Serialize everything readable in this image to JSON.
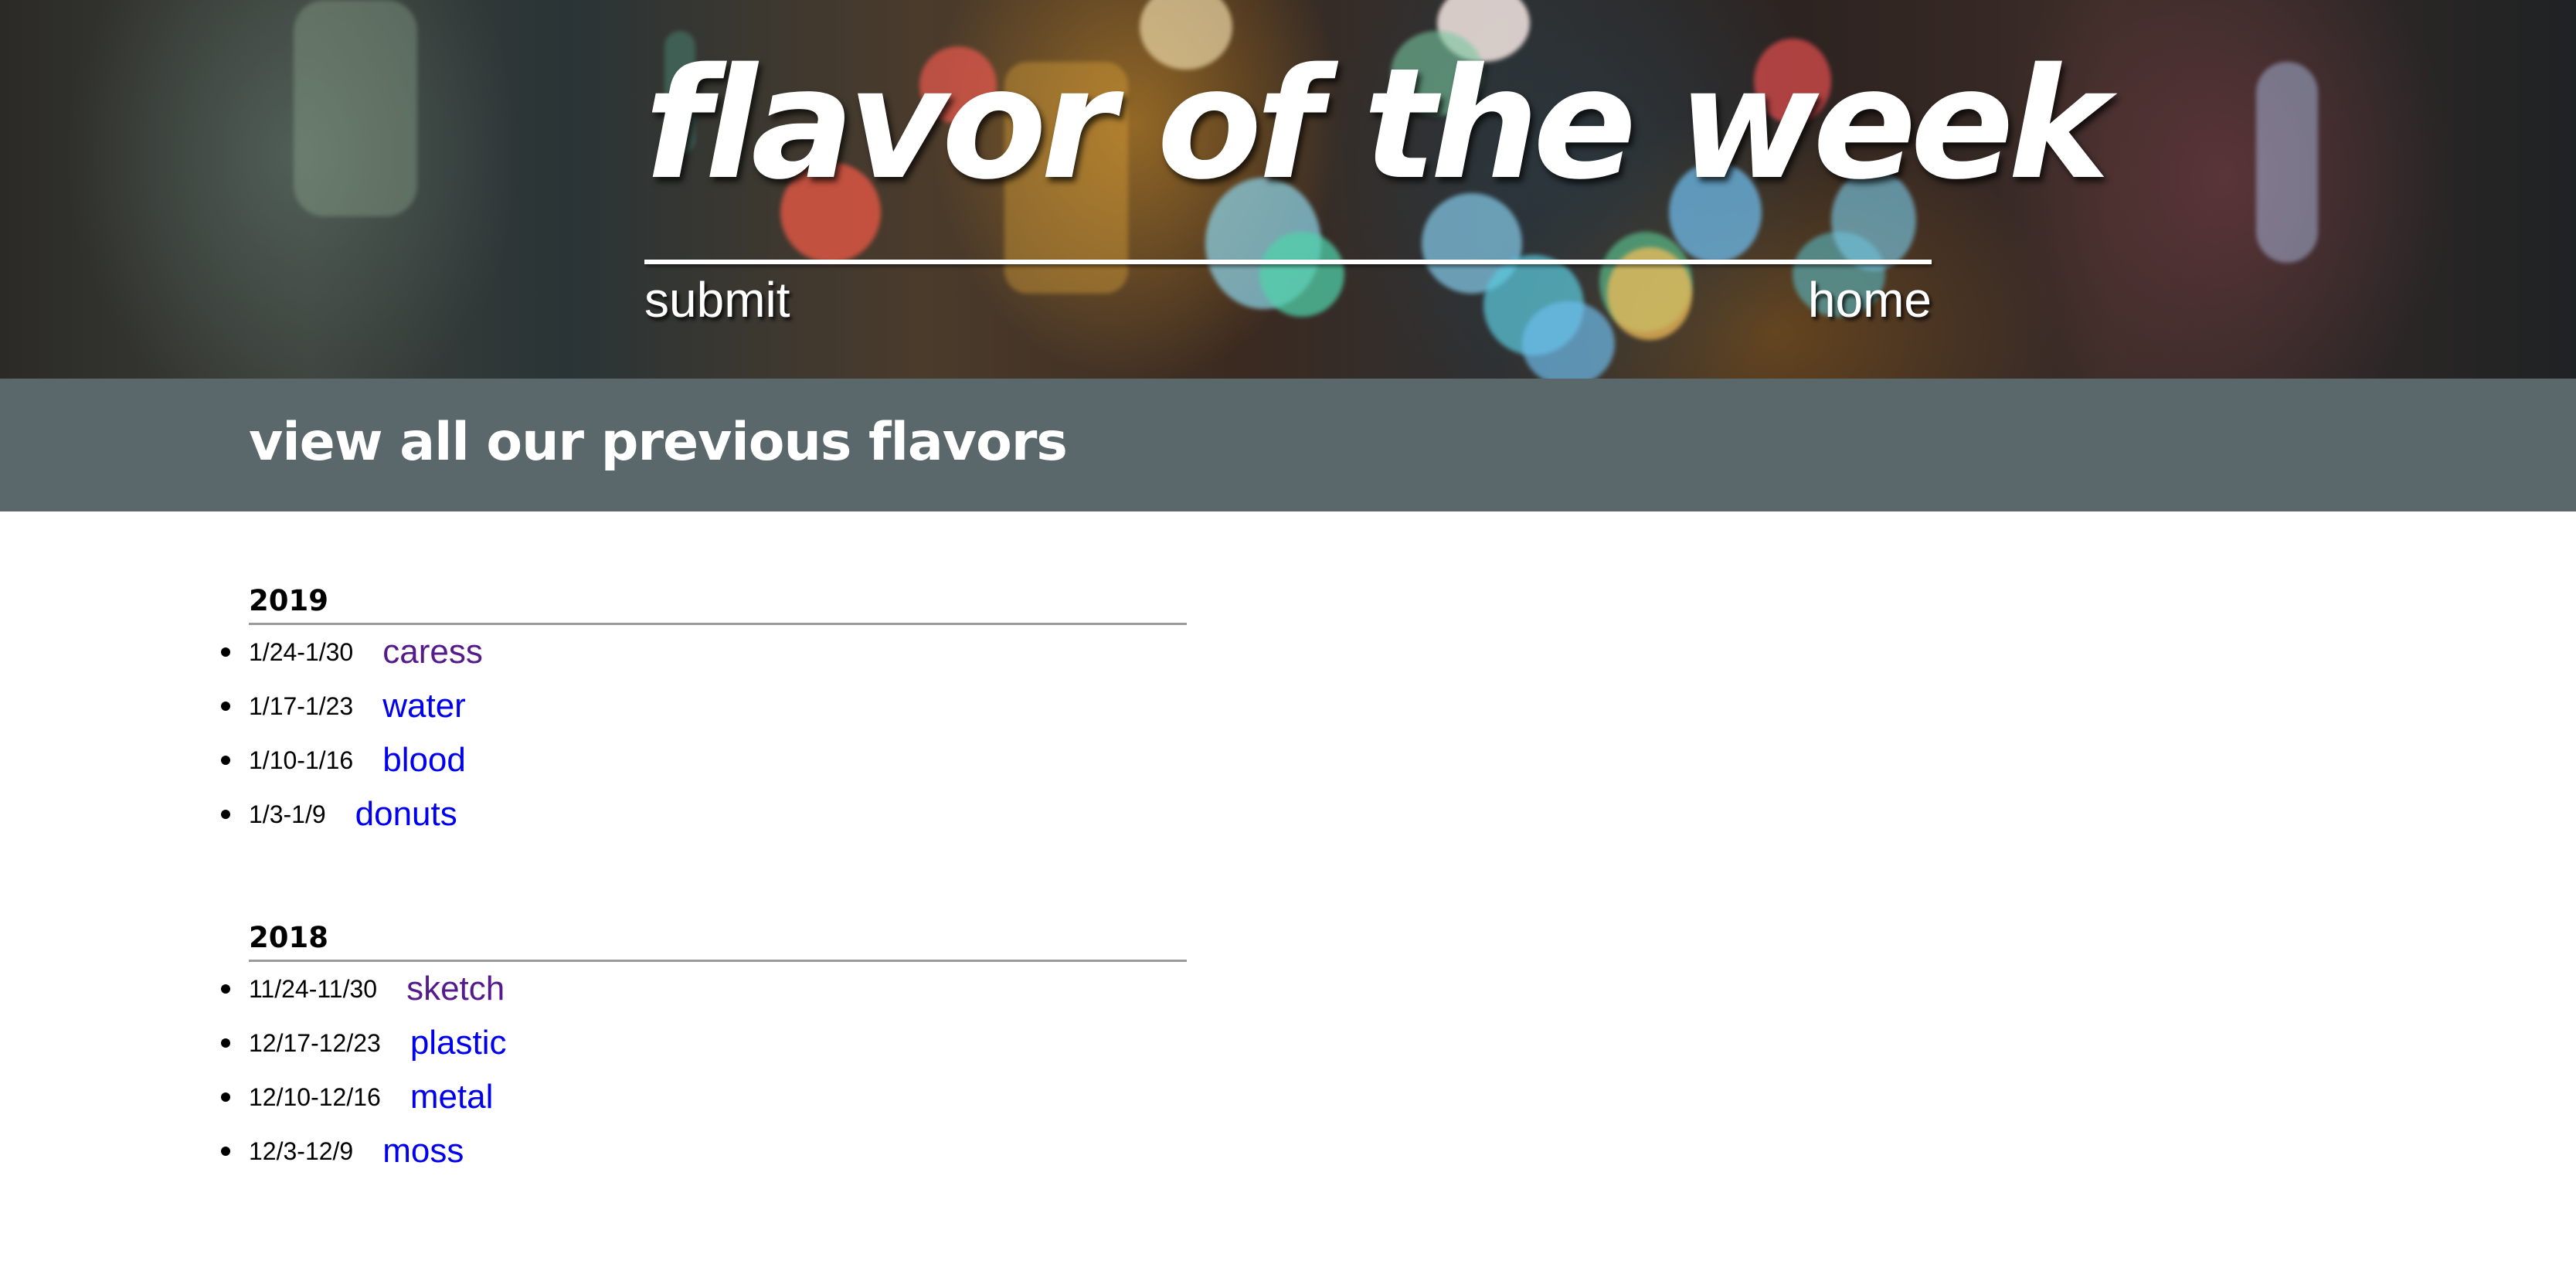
{
  "header": {
    "title": "flavor of the week",
    "nav": {
      "submit_label": "submit",
      "home_label": "home"
    }
  },
  "band": {
    "title": "view all our previous flavors"
  },
  "colors": {
    "band_background": "#5a676b",
    "link_unvisited": "#0000ee",
    "link_visited": "#551a8b",
    "rule": "#9a9a9a"
  },
  "archive": [
    {
      "year": "2019",
      "weeks": [
        {
          "dates": "1/24-1/30",
          "flavor": "caress",
          "visited": true
        },
        {
          "dates": "1/17-1/23",
          "flavor": "water",
          "visited": false
        },
        {
          "dates": "1/10-1/16",
          "flavor": "blood",
          "visited": false
        },
        {
          "dates": "1/3-1/9",
          "flavor": "donuts",
          "visited": false
        }
      ]
    },
    {
      "year": "2018",
      "weeks": [
        {
          "dates": "11/24-11/30",
          "flavor": "sketch",
          "visited": true
        },
        {
          "dates": "12/17-12/23",
          "flavor": "plastic",
          "visited": false
        },
        {
          "dates": "12/10-12/16",
          "flavor": "metal",
          "visited": false
        },
        {
          "dates": "12/3-12/9",
          "flavor": "moss",
          "visited": false
        }
      ]
    }
  ]
}
